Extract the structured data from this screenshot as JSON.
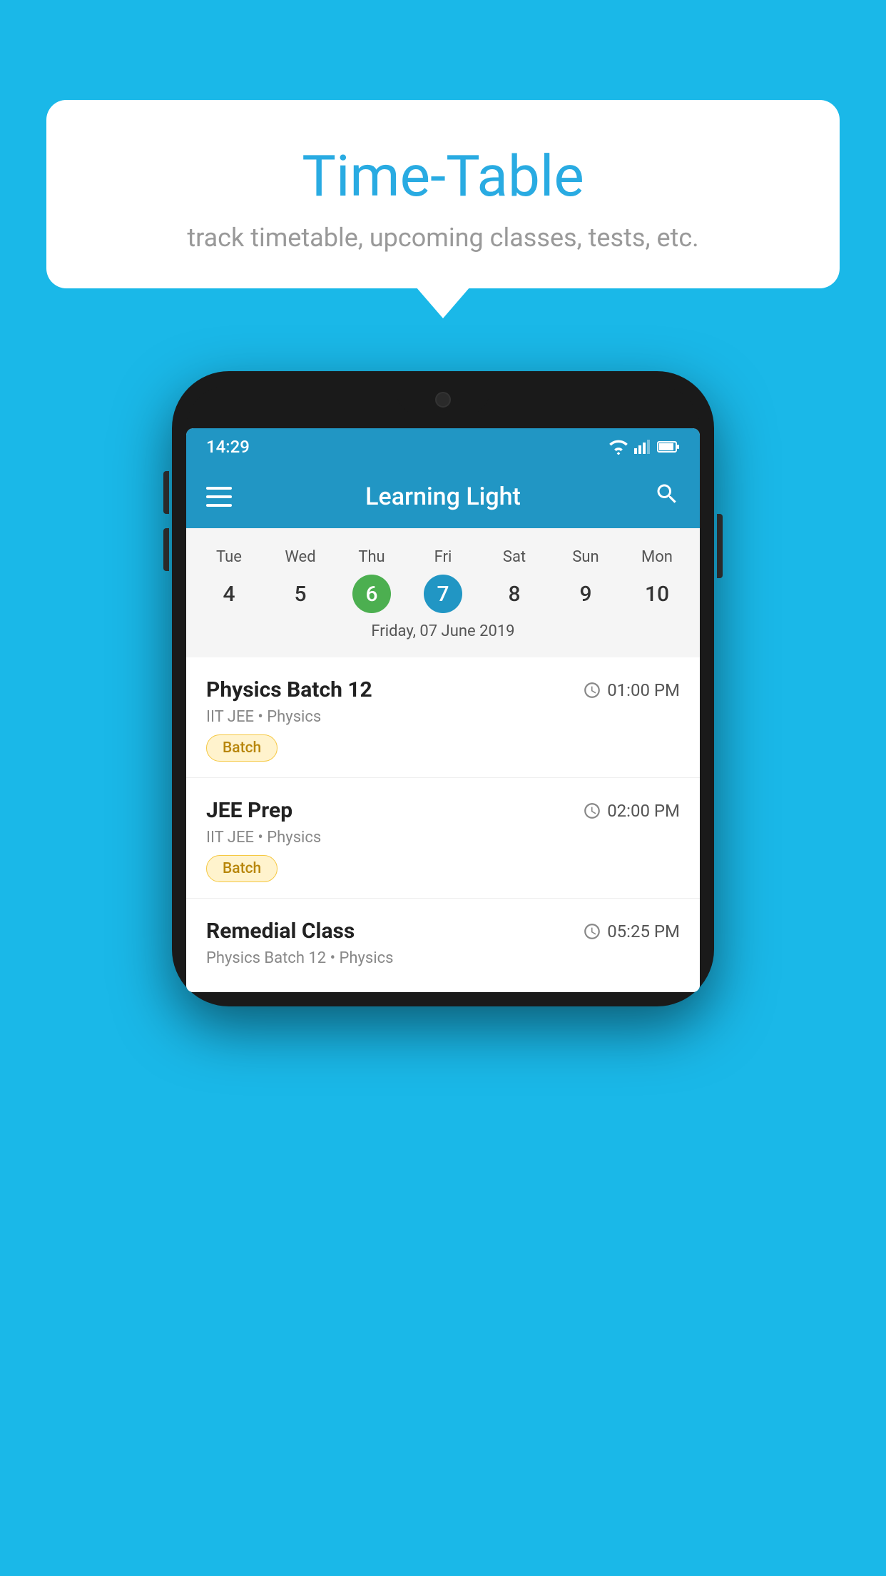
{
  "page": {
    "background_color": "#1ab8e8"
  },
  "speech_bubble": {
    "title": "Time-Table",
    "subtitle": "track timetable, upcoming classes, tests, etc."
  },
  "phone": {
    "status_bar": {
      "time": "14:29"
    },
    "app_bar": {
      "title": "Learning Light"
    },
    "calendar": {
      "days_of_week": [
        "Tue",
        "Wed",
        "Thu",
        "Fri",
        "Sat",
        "Sun",
        "Mon"
      ],
      "day_numbers": [
        "4",
        "5",
        "6",
        "7",
        "8",
        "9",
        "10"
      ],
      "today_index": 2,
      "selected_index": 3,
      "selected_date_label": "Friday, 07 June 2019"
    },
    "schedule": [
      {
        "title": "Physics Batch 12",
        "time": "01:00 PM",
        "subtitle": "IIT JEE • Physics",
        "badge": "Batch"
      },
      {
        "title": "JEE Prep",
        "time": "02:00 PM",
        "subtitle": "IIT JEE • Physics",
        "badge": "Batch"
      },
      {
        "title": "Remedial Class",
        "time": "05:25 PM",
        "subtitle": "Physics Batch 12 • Physics",
        "badge": null
      }
    ]
  }
}
